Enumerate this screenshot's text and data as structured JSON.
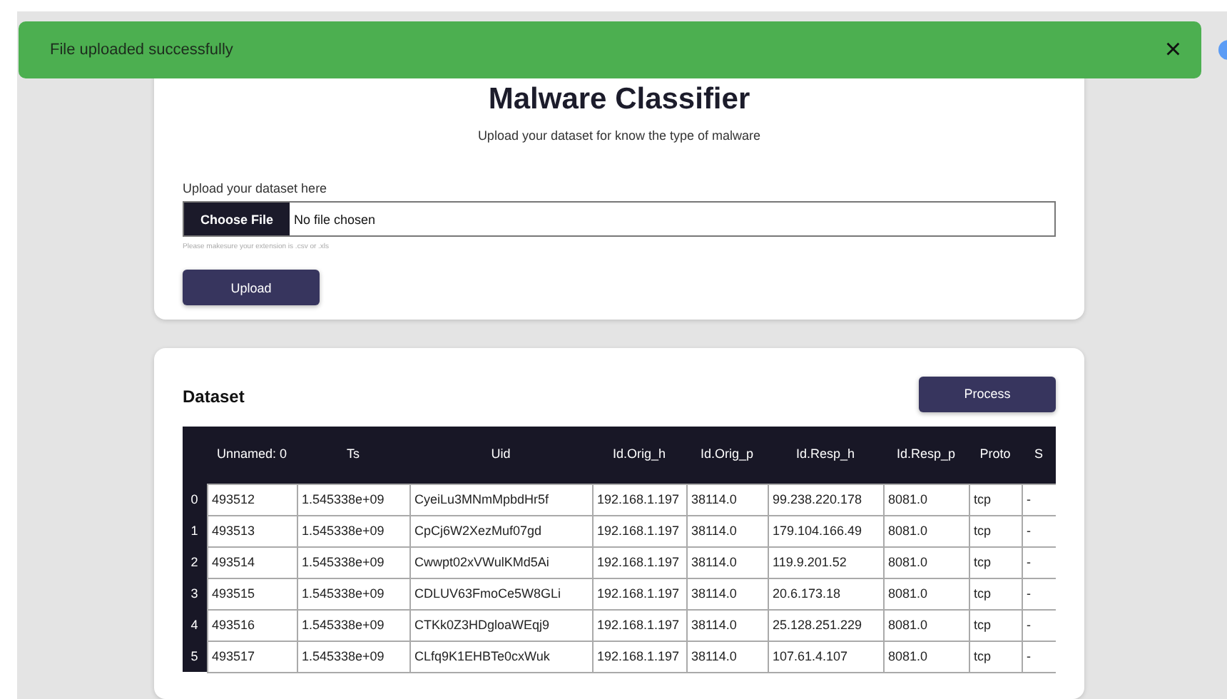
{
  "toast": {
    "message": "File uploaded successfully",
    "close": "×"
  },
  "upload_card": {
    "title": "Malware Classifier",
    "subtitle": "Upload your dataset for know the type of malware",
    "label": "Upload your dataset here",
    "file_button": "Choose File",
    "file_status": "No file chosen",
    "hint": "Please makesure your extension is .csv or .xls",
    "button": "Upload"
  },
  "dataset_card": {
    "title": "Dataset",
    "button": "Process",
    "table": {
      "columns": [
        "",
        "Unnamed: 0",
        "Ts",
        "Uid",
        "Id.Orig_h",
        "Id.Orig_p",
        "Id.Resp_h",
        "Id.Resp_p",
        "Proto",
        "S"
      ],
      "rows": [
        [
          "0",
          "493512",
          "1.545338e+09",
          "CyeiLu3MNmMpbdHr5f",
          "192.168.1.197",
          "38114.0",
          "99.238.220.178",
          "8081.0",
          "tcp",
          "-"
        ],
        [
          "1",
          "493513",
          "1.545338e+09",
          "CpCj6W2XezMuf07gd",
          "192.168.1.197",
          "38114.0",
          "179.104.166.49",
          "8081.0",
          "tcp",
          "-"
        ],
        [
          "2",
          "493514",
          "1.545338e+09",
          "Cwwpt02xVWulKMd5Ai",
          "192.168.1.197",
          "38114.0",
          "119.9.201.52",
          "8081.0",
          "tcp",
          "-"
        ],
        [
          "3",
          "493515",
          "1.545338e+09",
          "CDLUV63FmoCe5W8GLi",
          "192.168.1.197",
          "38114.0",
          "20.6.173.18",
          "8081.0",
          "tcp",
          "-"
        ],
        [
          "4",
          "493516",
          "1.545338e+09",
          "CTKk0Z3HDgloaWEqj9",
          "192.168.1.197",
          "38114.0",
          "25.128.251.229",
          "8081.0",
          "tcp",
          "-"
        ],
        [
          "5",
          "493517",
          "1.545338e+09",
          "CLfq9K1EHBTe0cxWuk",
          "192.168.1.197",
          "38114.0",
          "107.61.4.107",
          "8081.0",
          "tcp",
          "-"
        ]
      ]
    }
  }
}
